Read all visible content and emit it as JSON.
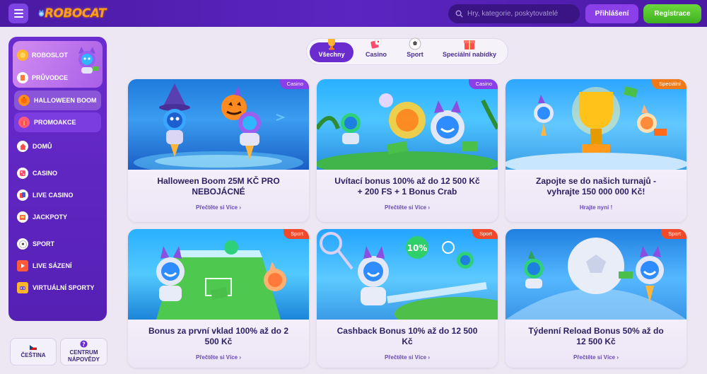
{
  "header": {
    "logo": "ROBOCAT",
    "search_placeholder": "Hry, kategorie, poskytovatelé",
    "login_label": "Přihlášení",
    "register_label": "Registrace"
  },
  "sidebar": {
    "promo_items": [
      "ROBOSLOT",
      "PRŮVODCE"
    ],
    "boxed_items": [
      "HALLOWEEN BOOM",
      "PROMOAKCE"
    ],
    "nav_items": [
      "DOMŮ",
      "CASINO",
      "LIVE CASINO",
      "JACKPOTY",
      "SPORT",
      "LIVE SÁZENÍ",
      "VIRTUÁLNÍ SPORTY"
    ],
    "language_label": "ČEŠTINA",
    "help_label_1": "CENTRUM",
    "help_label_2": "NÁPOVĚDY"
  },
  "tabs": [
    "Všechny",
    "Casino",
    "Sport",
    "Speciální nabídky"
  ],
  "cards": [
    {
      "badge": "Casino",
      "badge_color": "#8b3fe6",
      "title": "Halloween Boom 25M KČ PRO NEBOJÁCNÉ",
      "link": "Přečtěte si Více"
    },
    {
      "badge": "Casino",
      "badge_color": "#8b3fe6",
      "title": "Uvítací bonus 100% až do 12 500 Kč + 200 FS + 1 Bonus Crab",
      "link": "Přečtěte si Více"
    },
    {
      "badge": "Speciální",
      "badge_color": "#f07a1a",
      "title": "Zapojte se do našich turnajů - vyhrajte 150 000 000 Kč!",
      "link": "Hrajte nyní"
    },
    {
      "badge": "Sport",
      "badge_color": "#f04a2a",
      "title": "Bonus za první vklad 100% až do 2 500 Kč",
      "link": "Přečtěte si Více"
    },
    {
      "badge": "Sport",
      "badge_color": "#f04a2a",
      "title": "Cashback Bonus 10% až do 12 500 Kč",
      "link": "Přečtěte si Více"
    },
    {
      "badge": "Sport",
      "badge_color": "#f04a2a",
      "title": "Týdenní Reload Bonus 50% až do 12 500 Kč",
      "link": "Přečtěte si Více"
    }
  ],
  "colors": {
    "brand_purple": "#6a2ccf",
    "accent_green": "#4fc22a",
    "accent_orange": "#f07a1a"
  }
}
